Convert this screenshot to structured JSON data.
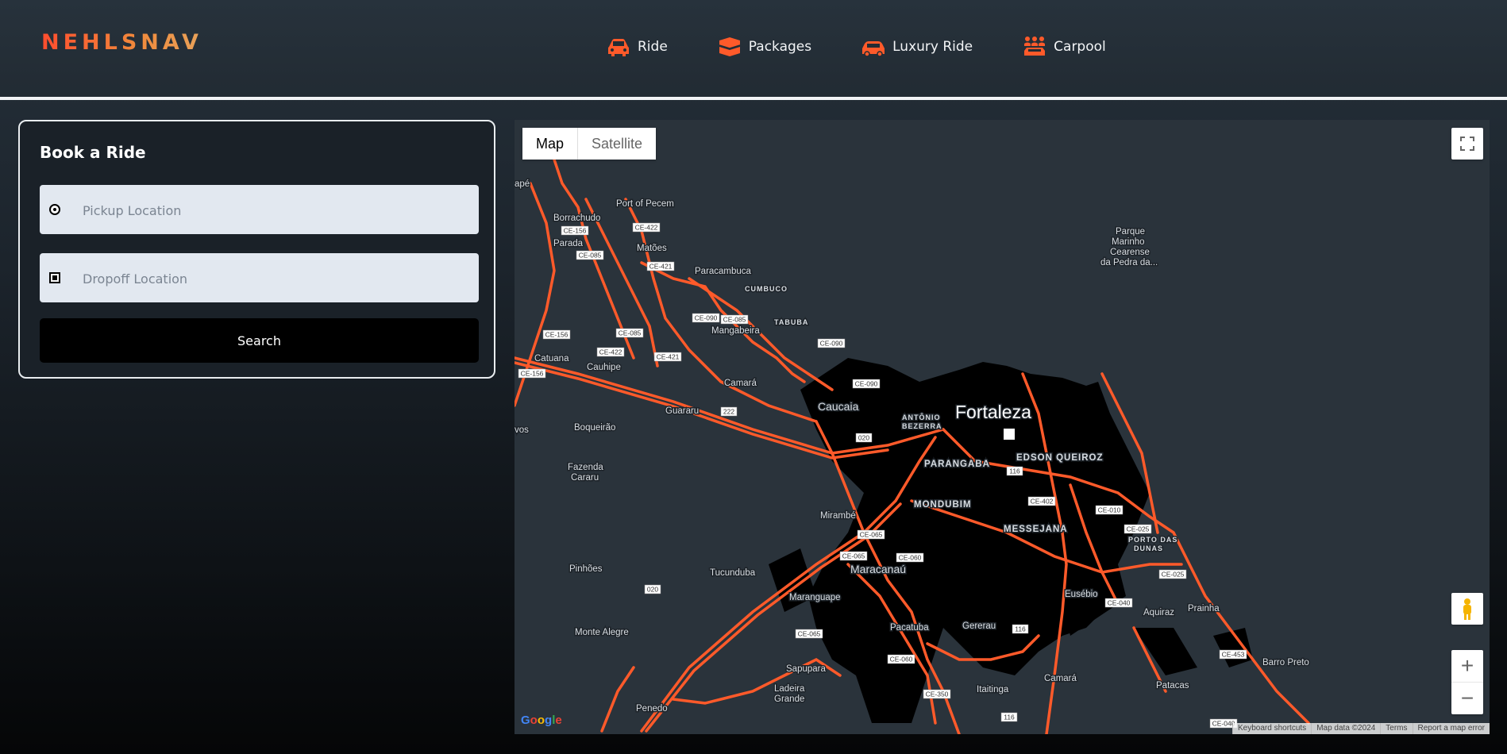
{
  "header": {
    "logo": "NEHLSNAV",
    "nav": [
      {
        "label": "Ride",
        "icon": "car-icon"
      },
      {
        "label": "Packages",
        "icon": "packages-icon"
      },
      {
        "label": "Luxury Ride",
        "icon": "luxury-car-icon"
      },
      {
        "label": "Carpool",
        "icon": "carpool-icon"
      }
    ]
  },
  "booking": {
    "title": "Book a Ride",
    "pickup_placeholder": "Pickup Location",
    "dropoff_placeholder": "Dropoff Location",
    "search_label": "Search"
  },
  "map": {
    "type_buttons": {
      "map": "Map",
      "satellite": "Satellite"
    },
    "google": "Google",
    "attribution": [
      "Keyboard shortcuts",
      "Map data ©2024",
      "Terms",
      "Report a map error"
    ],
    "labels": {
      "fortaleza": "Fortaleza",
      "caucaia": "Caucaia",
      "maracanau": "Maracanaú",
      "port_pecem": "Port of Pecem",
      "borrachudo": "Borrachudo",
      "parada": "Parada",
      "matoes": "Matões",
      "paracambuca": "Paracambuca",
      "cumbuco": "CUMBUCO",
      "tabuba": "TABUBA",
      "mangabeira": "Mangabeira",
      "catuana": "Catuana",
      "cauhipe": "Cauhipe",
      "camara": "Camará",
      "guararu": "Guararu",
      "boqueirao": "Boqueirão",
      "fazenda_cararu_1": "Fazenda",
      "fazenda_cararu_2": "Cararu",
      "antonio_bezerra_1": "ANTÔNIO",
      "antonio_bezerra_2": "BEZERRA",
      "parangaba": "PARANGABA",
      "edson_queiroz": "EDSON QUEIROZ",
      "mondubim": "MONDUBIM",
      "messejana": "MESSEJANA",
      "porto_dunas_1": "PORTO DAS",
      "porto_dunas_2": "DUNAS",
      "mirambe": "Mirambé",
      "pinhoes": "Pinhões",
      "tucunduba": "Tucunduba",
      "maranguape": "Maranguape",
      "monte_alegre": "Monte Alegre",
      "pacatuba": "Pacatuba",
      "gererau": "Gererau",
      "eusebio": "Eusébio",
      "aquiraz": "Aquiraz",
      "prainha": "Prainha",
      "sapupara": "Sapupara",
      "ladeira_1": "Ladeira",
      "ladeira_2": "Grande",
      "penedo": "Penedo",
      "itaitinga": "Itaitinga",
      "camara2": "Camará",
      "barro_preto": "Barro Preto",
      "patacas": "Patacas",
      "parque_1": "Parque",
      "parque_2": "Marinho",
      "parque_3": "Cearense",
      "parque_4": "da Pedra da...",
      "ape": "apé",
      "vos": "vos"
    },
    "shields": {
      "ce156a": "CE-156",
      "ce085a": "CE-085",
      "ce422a": "CE-422",
      "ce421a": "CE-421",
      "ce090a": "CE-090",
      "ce085b": "CE-085",
      "ce156b": "CE-156",
      "ce085c": "CE-085",
      "ce422b": "CE-422",
      "ce421b": "CE-421",
      "ce156c": "CE-156",
      "ce090b": "CE-090",
      "ce090c": "CE-090",
      "r222": "222",
      "r020a": "020",
      "r116a": "116",
      "ce402": "CE-402",
      "ce010": "CE-010",
      "ce025a": "CE-025",
      "ce065a": "CE-065",
      "ce065b": "CE-065",
      "ce060a": "CE-060",
      "ce025b": "CE-025",
      "ce040a": "CE-040",
      "r020b": "020",
      "ce065c": "CE-065",
      "r116b": "116",
      "ce060b": "CE-060",
      "ce453": "CE-453",
      "ce350": "CE-350",
      "r116c": "116",
      "ce040b": "CE-040"
    }
  },
  "colors": {
    "accent": "#ff5a2a",
    "road": "#ff5a2a",
    "urban": "#000000",
    "map_bg": "#2a333b"
  }
}
